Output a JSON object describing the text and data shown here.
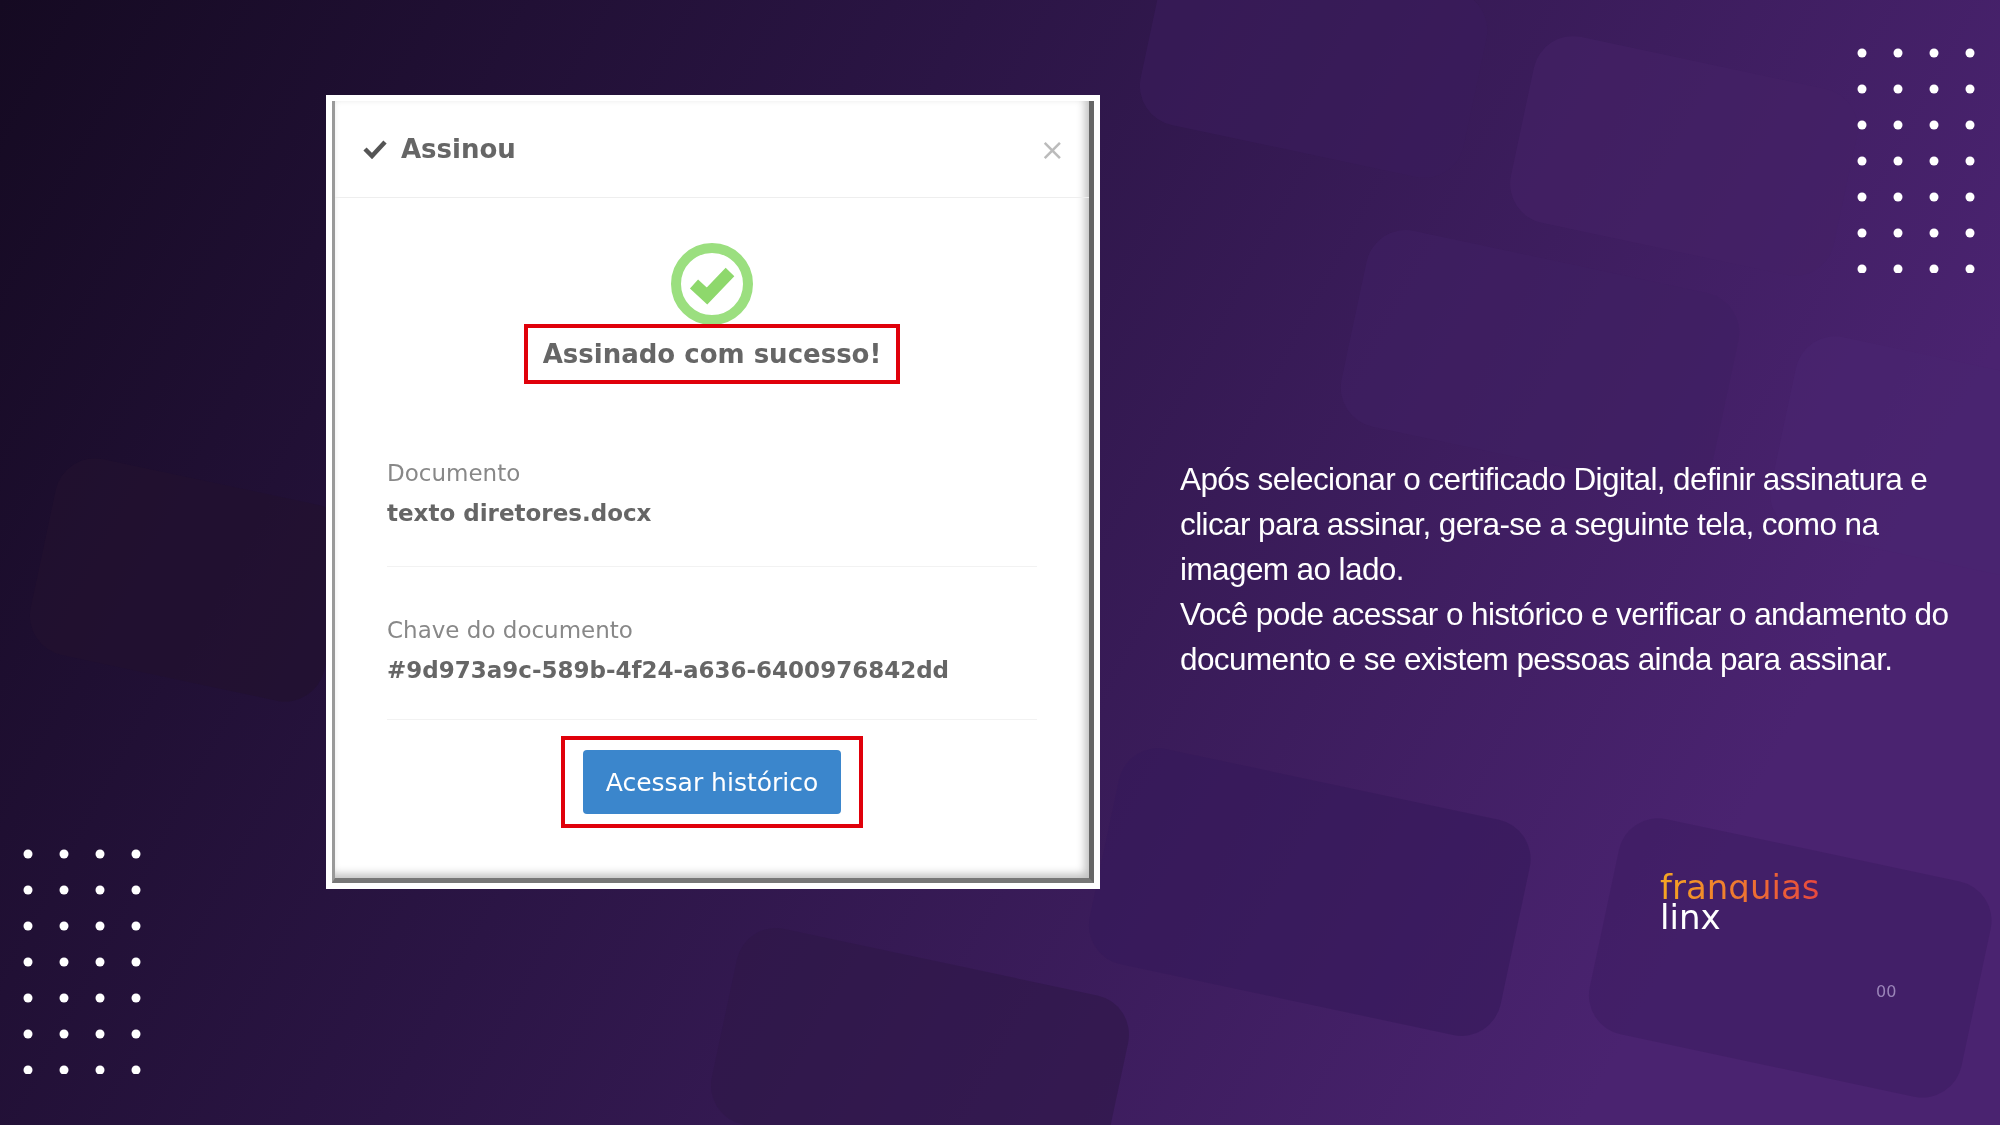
{
  "dialog": {
    "title": "Assinou",
    "close": "×",
    "heading": {
      "text": "Assinado com sucesso!",
      "highlighted": true
    },
    "fields": [
      {
        "label": "Documento",
        "value": "texto diretores.docx"
      },
      {
        "label": "Chave do documento",
        "value": "#9d973a9c-589b-4f24-a636-6400976842dd"
      }
    ],
    "button": {
      "text": "Acessar histórico",
      "highlighted": true
    }
  },
  "description": [
    "Após selecionar o certificado Digital, definir assinatura e clicar para assinar, gera-se a seguinte tela, como na imagem ao lado.",
    "Você pode acessar o histórico e verificar o andamento do documento e se existem pessoas ainda para assinar."
  ],
  "logo": {
    "line_1": "franquias",
    "line_2": "linx"
  },
  "page_number": "00"
}
